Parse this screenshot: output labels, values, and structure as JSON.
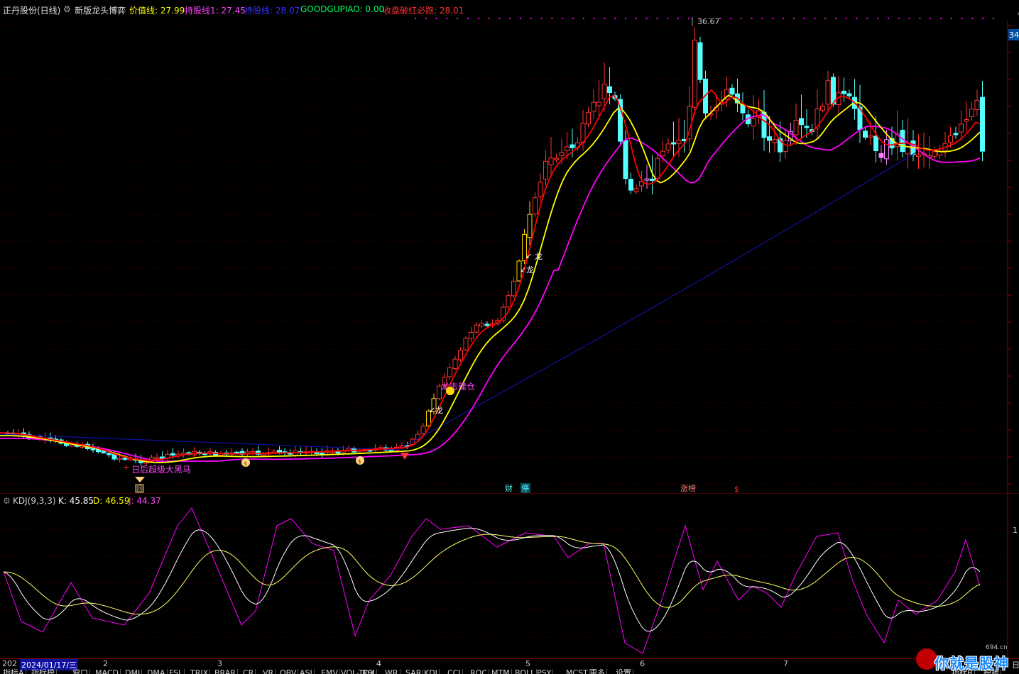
{
  "header": {
    "stock_name": "正丹股份(日线)",
    "indicator_name": "新版龙头博弈",
    "values": [
      {
        "label": "价值线: 27.99",
        "color": "#ffff00"
      },
      {
        "label": "持股线1: 27.45",
        "color": "#ff44ff"
      },
      {
        "label": "持股线: 28.07",
        "color": "#3333ff"
      },
      {
        "label": "GOODGUPIAO: 0.00",
        "color": "#00ff66"
      },
      {
        "label": "收盘破红必跑: 28.01",
        "color": "#ff3333"
      }
    ]
  },
  "price_axis": {
    "right_label": "34"
  },
  "main_chart": {
    "peak_label": "36.67",
    "signals": {
      "long1": "龙",
      "long2": "龙",
      "long3": "龙",
      "zhuang_label": "龙志建仓",
      "black_horse": "日后超级大黑马",
      "fund_char": "回"
    },
    "bottom_labels": {
      "cai": "财",
      "ting": "停",
      "zhangbang": "涨榜",
      "dollar": "$"
    },
    "colors": {
      "up": "#ff3232",
      "down": "#54ffff",
      "ma_red": "#ff0000",
      "ma_yellow": "#ffff00",
      "ma_magenta": "#ff00ff",
      "ma_blue": "#0000a0",
      "yellow_candle": "#ffd700",
      "pink_candle": "#ff7fff"
    }
  },
  "kdj": {
    "title": "KDJ(9,3,3)",
    "k": "K: 45.85",
    "d": "D: 46.59",
    "j": "J: 44.37",
    "axis_label": "1",
    "colors": {
      "k": "#ffffff",
      "d": "#ffff00",
      "j": "#ff00ff"
    }
  },
  "date_bar": {
    "labels": [
      "202",
      "2024/01/17/三",
      "2",
      "3",
      "4",
      "5",
      "6",
      "7"
    ],
    "right_char": "日"
  },
  "tabs": [
    "指标A",
    "指标模",
    "窗口",
    "MACD",
    "DMI",
    "DMA",
    "FSL",
    "TRIX",
    "BRAR",
    "CR",
    "VR",
    "OBV",
    "ASI",
    "EMV",
    "VOL-TDX",
    "RSI",
    "WR",
    "SAR",
    "KDJ",
    "CCI",
    "ROC",
    "MTM",
    "BOLL",
    "PSY",
    "MCST",
    "更多",
    "设置"
  ],
  "tabs_right": [
    "指标B",
    "模板"
  ],
  "watermark": {
    "text": "你就是股神",
    "url": "694.cn"
  }
}
